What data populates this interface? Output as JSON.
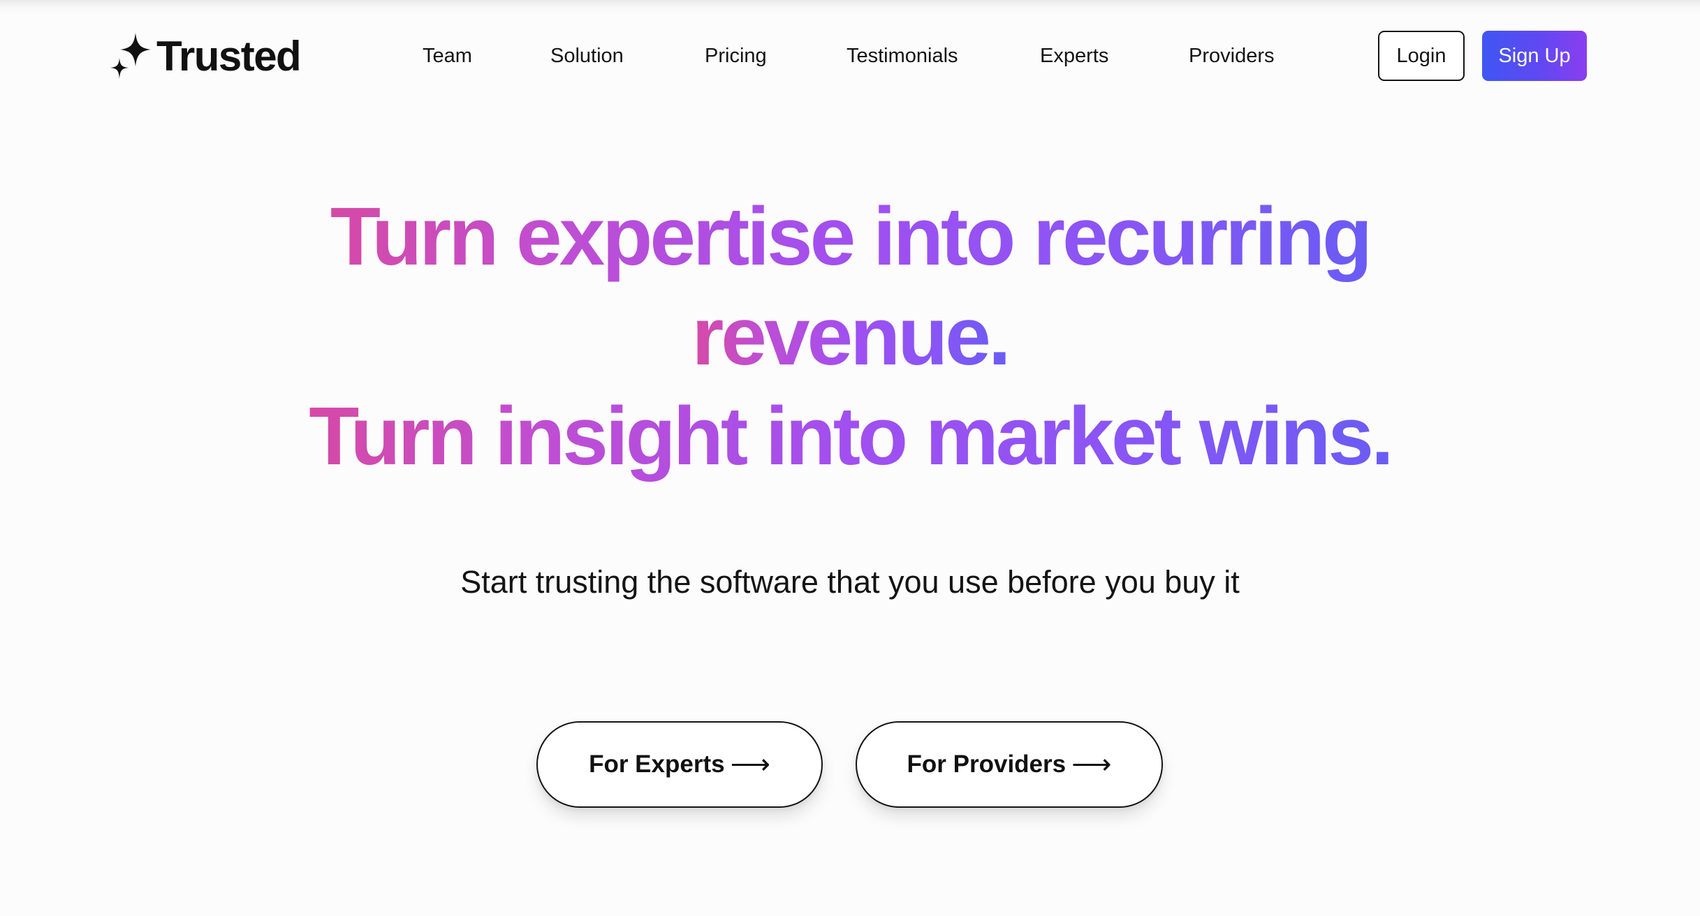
{
  "header": {
    "logo_text": "Trusted",
    "logo_icon": "sparkle-icon",
    "nav": [
      {
        "label": "Team"
      },
      {
        "label": "Solution"
      },
      {
        "label": "Pricing"
      },
      {
        "label": "Testimonials"
      },
      {
        "label": "Experts"
      },
      {
        "label": "Providers"
      }
    ],
    "login_label": "Login",
    "signup_label": "Sign Up"
  },
  "hero": {
    "headline_lines": [
      "Turn expertise into recurring",
      "revenue.",
      "Turn insight into market wins."
    ],
    "subtitle": "Start trusting the software that you use before you buy it",
    "cta_experts_label": "For Experts",
    "cta_providers_label": "For Providers",
    "arrow_glyph": "⟶"
  },
  "colors": {
    "gradient_start": "#d64aa6",
    "gradient_mid": "#a14ff0",
    "gradient_end": "#6a5cf4",
    "signup_bg_start": "#3f56f2",
    "signup_bg_end": "#8a3ef0",
    "text": "#111111",
    "background": "#fcfcfc"
  }
}
